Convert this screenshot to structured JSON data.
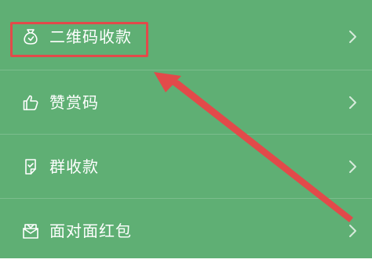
{
  "menu": {
    "items": [
      {
        "label": "二维码收款",
        "icon": "qr-money-bag-icon"
      },
      {
        "label": "赞赏码",
        "icon": "thumbs-up-icon"
      },
      {
        "label": "群收款",
        "icon": "group-collect-icon"
      },
      {
        "label": "面对面红包",
        "icon": "red-packet-icon"
      }
    ]
  },
  "colors": {
    "background": "#5faf74",
    "text": "#ffffff",
    "annotation": "#e24a4a"
  }
}
